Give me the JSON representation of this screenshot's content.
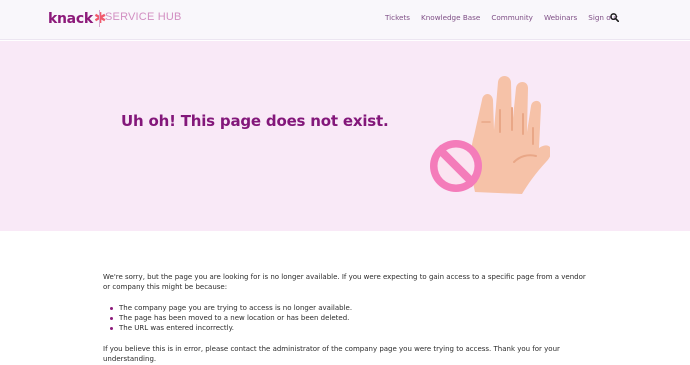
{
  "header": {
    "logo_text": "knack",
    "logo_mark": "✱",
    "logo_subtitle": "SERVICE HUB",
    "nav": [
      "Tickets",
      "Knowledge Base",
      "Community",
      "Webinars",
      "Sign out"
    ],
    "search_icon": "search-icon"
  },
  "hero": {
    "title": "Uh oh! This page does not exist.",
    "illustration_icon": "stop-hand-icon",
    "colors": {
      "background": "#f9e9f7",
      "title": "#83177a",
      "hand": "#f6c2a8",
      "stop_sign": "#f47cba"
    }
  },
  "content": {
    "intro": "We're sorry, but the page you are looking for is no longer available. If you were expecting to gain access to a specific page from a vendor or company this might be because:",
    "reasons": [
      "The company page you are trying to access is no longer available.",
      "The page has been moved to a new location or has been deleted.",
      "The URL was entered incorrectly."
    ],
    "closing": "If you believe this is in error, please contact the administrator of the company page you were trying to access. Thank you for your understanding."
  }
}
